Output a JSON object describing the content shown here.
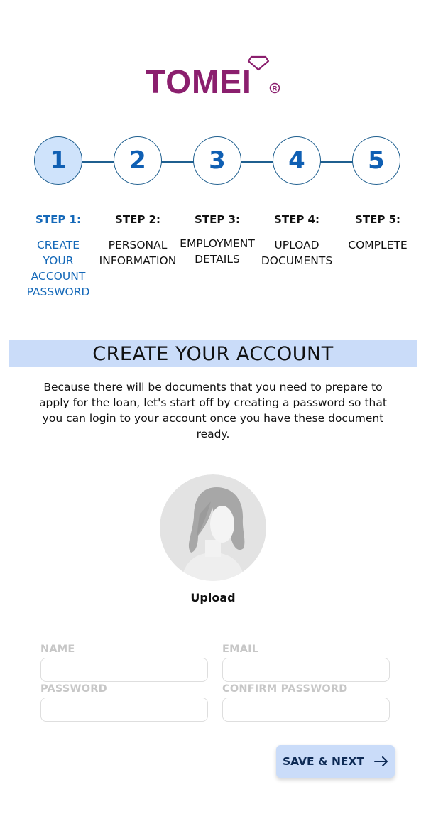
{
  "logo": {
    "text": "TOMEI",
    "brand_color": "#8b1f6e"
  },
  "steps": [
    {
      "number": "1",
      "label": "STEP 1:",
      "desc_lines": [
        "CREATE",
        "YOUR",
        "ACCOUNT",
        "PASSWORD"
      ],
      "active": true
    },
    {
      "number": "2",
      "label": "STEP 2:",
      "desc_lines": [
        "PERSONAL",
        "INFORMATION"
      ],
      "active": false
    },
    {
      "number": "3",
      "label": "STEP 3:",
      "desc_lines": [
        "EMPLOYMENT",
        "DETAILS"
      ],
      "active": false
    },
    {
      "number": "4",
      "label": "STEP 4:",
      "desc_lines": [
        "UPLOAD",
        "DOCUMENTS"
      ],
      "active": false
    },
    {
      "number": "5",
      "label": "STEP 5:",
      "desc_lines": [
        "COMPLETE"
      ],
      "active": false
    }
  ],
  "banner": {
    "title": "CREATE YOUR ACCOUNT",
    "color": "#cadcf9"
  },
  "intro_text": "Because there will be documents that you need to prepare to apply for the loan, let's start off by creating a password so that you can login to your account once you have these document ready.",
  "avatar": {
    "upload_label": "Upload"
  },
  "form": {
    "name_label": "NAME",
    "email_label": "EMAIL",
    "password_label": "PASSWORD",
    "confirm_password_label": "CONFIRM PASSWORD",
    "name_value": "",
    "email_value": "",
    "password_value": "",
    "confirm_password_value": ""
  },
  "save_button": {
    "label": "SAVE & NEXT",
    "icon": "arrow-right-icon"
  },
  "accent_color": "#1468b8"
}
